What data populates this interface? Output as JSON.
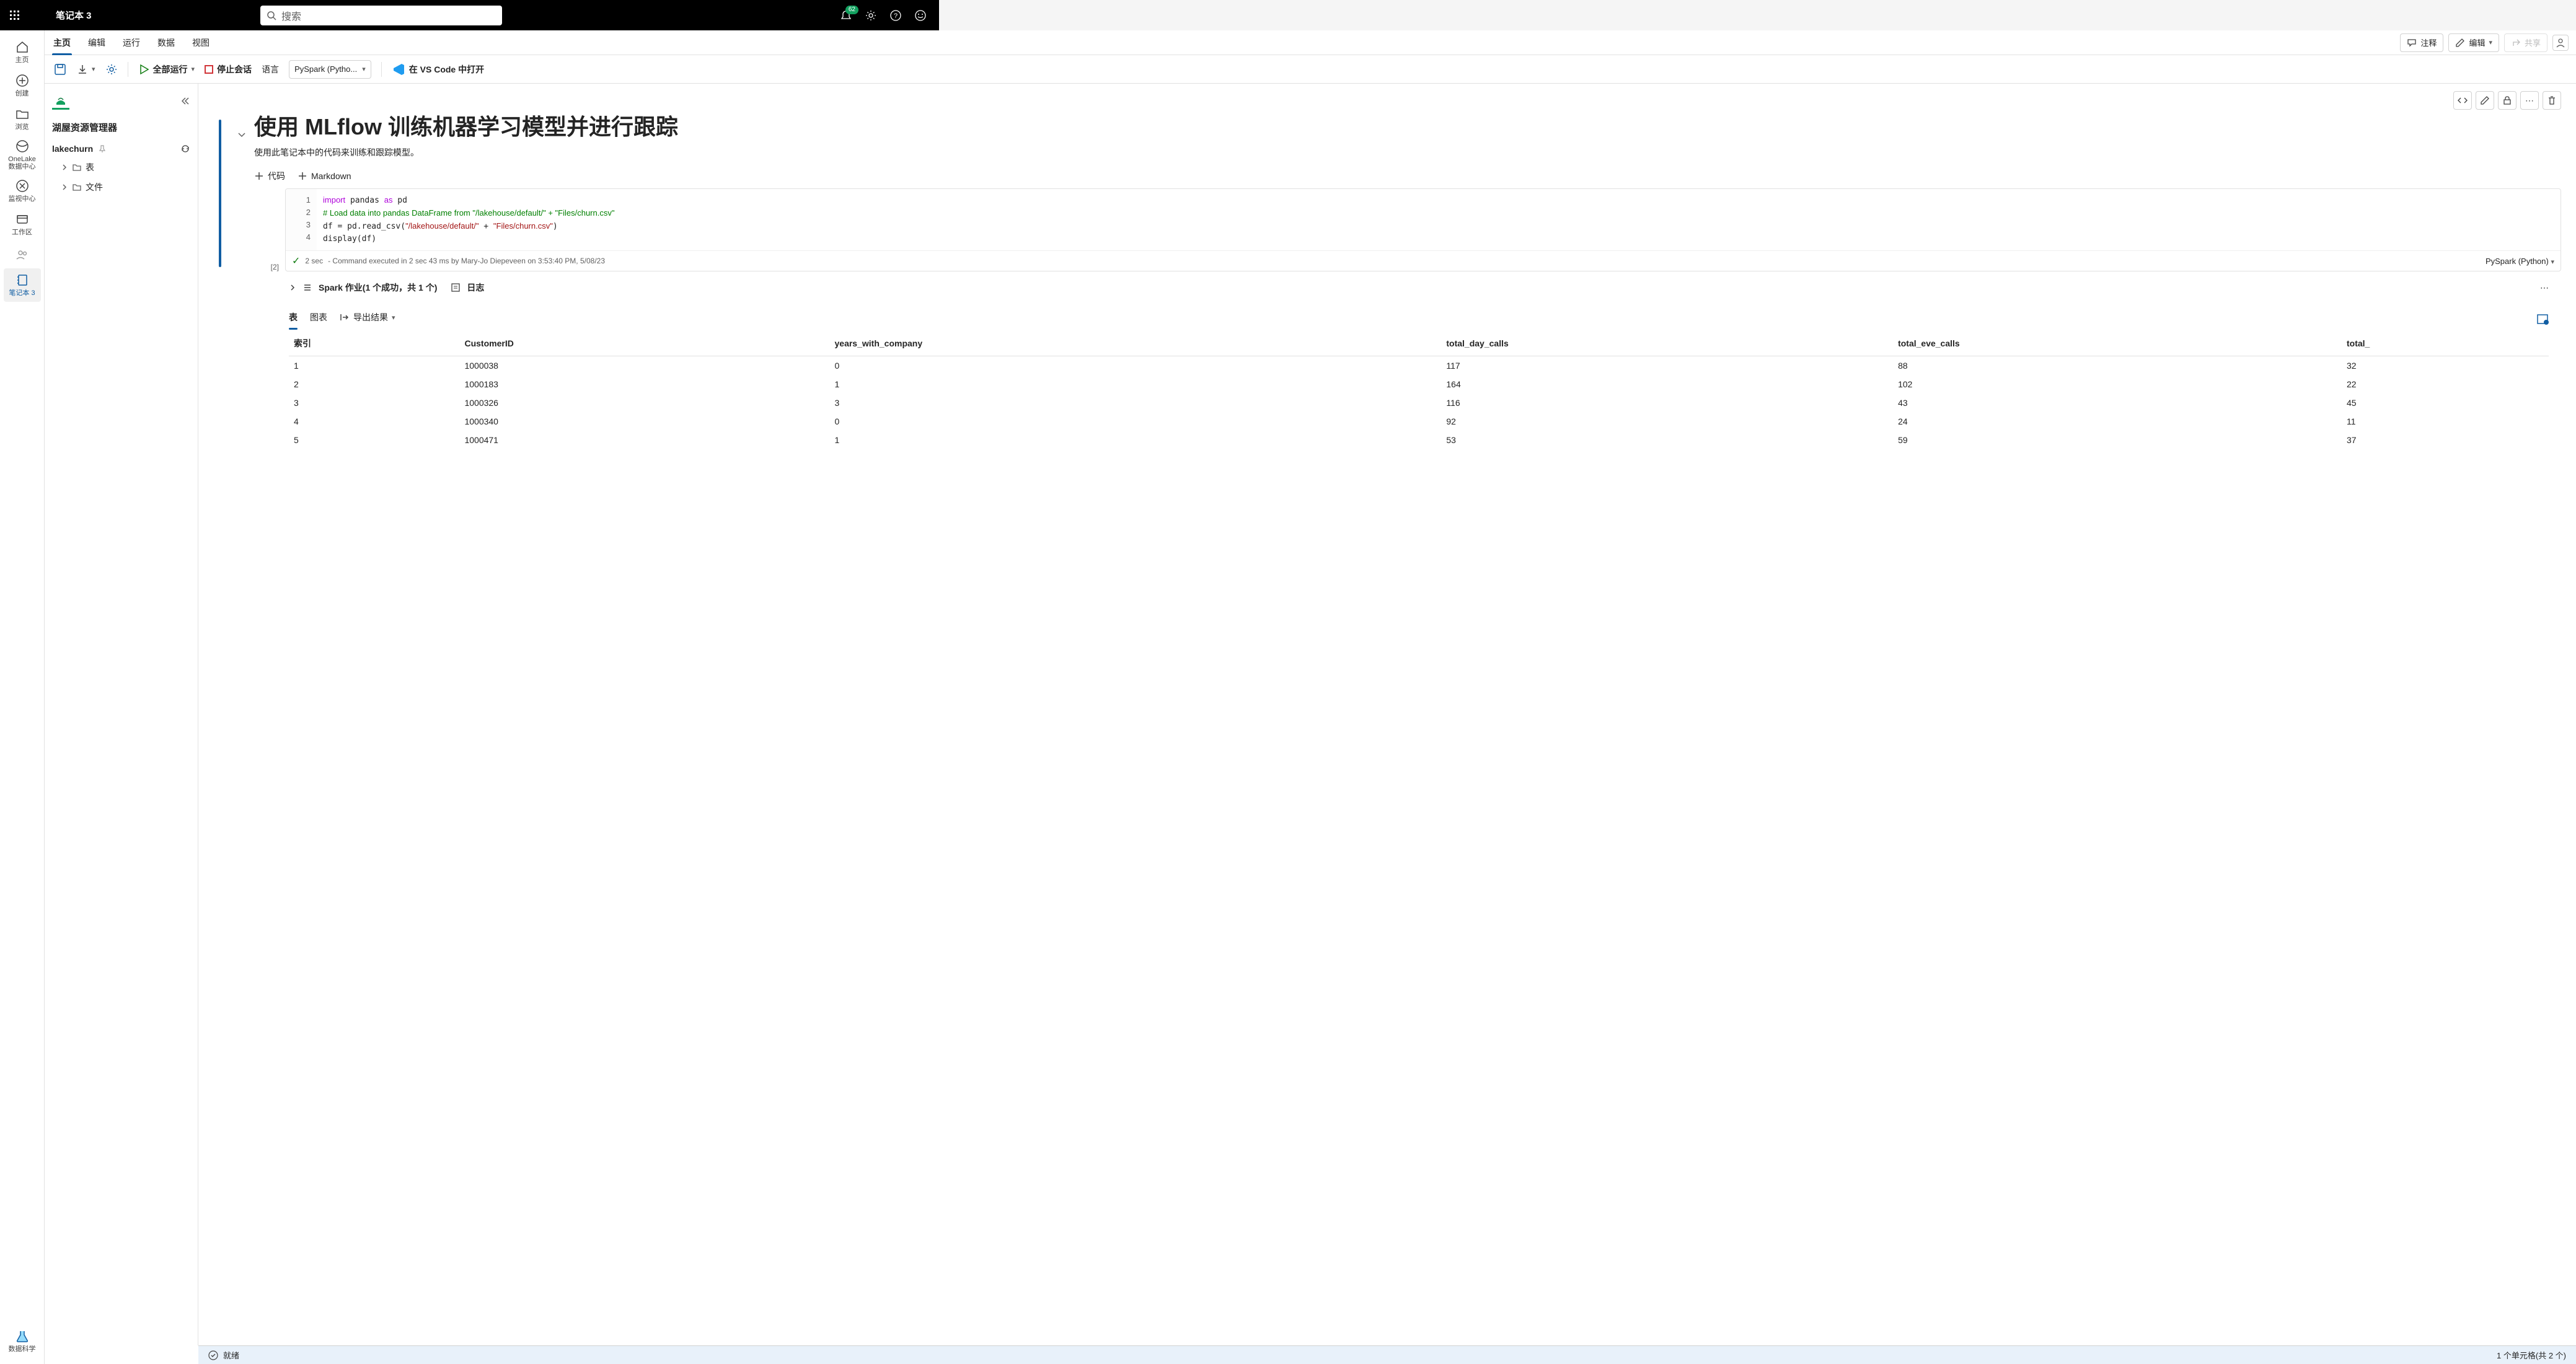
{
  "notification_count": "62",
  "tab_title": "笔记本 3",
  "search_placeholder": "搜索",
  "rail": {
    "home": "主页",
    "create": "创建",
    "browse": "浏览",
    "onelake": "OneLake\n数据中心",
    "monitor": "监视中心",
    "workspace": "工作区",
    "notebook": "笔记本 3",
    "ds": "数据科学"
  },
  "ribbon": {
    "tabs": [
      "主页",
      "编辑",
      "运行",
      "数据",
      "视图"
    ],
    "comment": "注释",
    "edit": "编辑",
    "share": "共享"
  },
  "toolbar": {
    "runall": "全部运行",
    "stop": "停止会话",
    "lang_label": "语言",
    "lang_value": "PySpark (Pytho...",
    "vscode": "在 VS Code 中打开"
  },
  "panel": {
    "title": "湖屋资源管理器",
    "lakehouse": "lakechurn",
    "tables": "表",
    "files": "文件"
  },
  "notebook": {
    "title": "使用 MLflow 训练机器学习模型并进行跟踪",
    "subtitle": "使用此笔记本中的代码来训练和跟踪模型。",
    "add_code": "代码",
    "add_md": "Markdown",
    "cell_num": "[2]",
    "code_lines": [
      "1",
      "2",
      "3",
      "4"
    ],
    "exec_time": "2 sec",
    "exec_status": "- Command executed in 2 sec 43 ms by Mary-Jo Diepeveen on 3:53:40 PM, 5/08/23",
    "exec_lang": "PySpark (Python)",
    "spark_jobs": "Spark 作业(1 个成功，共 1 个)",
    "logs": "日志"
  },
  "output": {
    "tab_table": "表",
    "tab_chart": "图表",
    "export": "导出结果",
    "columns": [
      "索引",
      "CustomerID",
      "years_with_company",
      "total_day_calls",
      "total_eve_calls",
      "total_"
    ],
    "rows": [
      [
        "1",
        "1000038",
        "0",
        "117",
        "88",
        "32"
      ],
      [
        "2",
        "1000183",
        "1",
        "164",
        "102",
        "22"
      ],
      [
        "3",
        "1000326",
        "3",
        "116",
        "43",
        "45"
      ],
      [
        "4",
        "1000340",
        "0",
        "92",
        "24",
        "11"
      ],
      [
        "5",
        "1000471",
        "1",
        "53",
        "59",
        "37"
      ]
    ]
  },
  "status": {
    "ready": "就绪",
    "cells": "1 个单元格(共 2 个)"
  }
}
